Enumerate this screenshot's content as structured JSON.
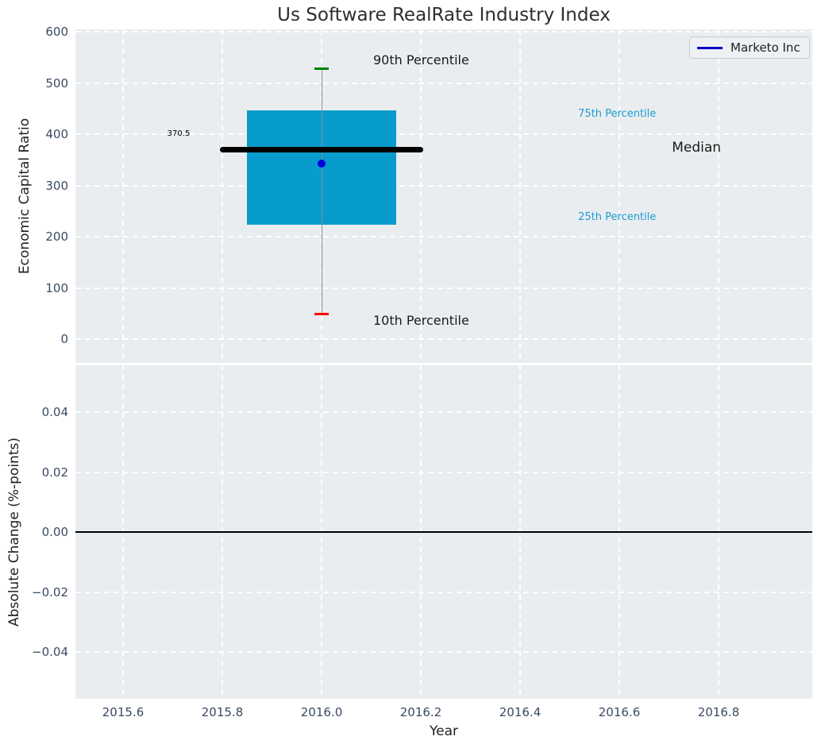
{
  "title": "Us Software RealRate Industry Index",
  "legend": {
    "label": "Marketo Inc",
    "line_color": "#0000cc"
  },
  "chart_data": {
    "type": "boxplot",
    "title": "Us Software RealRate Industry Index",
    "xlabel": "Year",
    "x_ticks": [
      {
        "v": 2015.6,
        "label": "2015.6"
      },
      {
        "v": 2015.8,
        "label": "2015.8"
      },
      {
        "v": 2016.0,
        "label": "2016.0"
      },
      {
        "v": 2016.2,
        "label": "2016.2"
      },
      {
        "v": 2016.4,
        "label": "2016.4"
      },
      {
        "v": 2016.6,
        "label": "2016.6"
      },
      {
        "v": 2016.8,
        "label": "2016.8"
      }
    ],
    "xlim": [
      2015.5,
      2016.99
    ],
    "top_panel": {
      "ylabel": "Economic Capital Ratio",
      "ylim": [
        -46,
        604
      ],
      "y_ticks": [
        {
          "v": 0,
          "label": "0"
        },
        {
          "v": 100,
          "label": "100"
        },
        {
          "v": 200,
          "label": "200"
        },
        {
          "v": 300,
          "label": "300"
        },
        {
          "v": 400,
          "label": "400"
        },
        {
          "v": 500,
          "label": "500"
        },
        {
          "v": 600,
          "label": "600"
        }
      ],
      "box": {
        "x_center": 2016.0,
        "box_x_range": [
          2015.85,
          2016.15
        ],
        "median_x_range": [
          2015.795,
          2016.205
        ],
        "cap_half_width": 0.0145,
        "p10": 50,
        "p25": 223.5,
        "median": 370.5,
        "p75": 446.5,
        "p90": 529,
        "company_value": 343,
        "colors": {
          "box_fill": "#089ccd",
          "median_line": "#000000",
          "whisker_line": "#8a8a8a",
          "cap_top": "#008000",
          "cap_bottom": "#ff0000",
          "company_dot": "#0000dd"
        }
      },
      "annotations": [
        {
          "text": "90th Percentile",
          "x": 2016.104,
          "y": 543,
          "color": "#1a1a1a",
          "size": 16,
          "align": "left"
        },
        {
          "text": "10th Percentile",
          "x": 2016.104,
          "y": 34,
          "color": "#1a1a1a",
          "size": 16,
          "align": "left"
        },
        {
          "text": "75th Percentile",
          "x": 2016.517,
          "y": 437,
          "color": "#1a9cd4",
          "size": 13,
          "align": "left"
        },
        {
          "text": "25th Percentile",
          "x": 2016.517,
          "y": 236,
          "color": "#1a9cd4",
          "size": 13,
          "align": "left"
        },
        {
          "text": "Median",
          "x": 2016.706,
          "y": 372,
          "color": "#1a1a1a",
          "size": 17,
          "align": "left"
        },
        {
          "text": "370.5",
          "x": 2015.712,
          "y": 399,
          "color": "#000000",
          "size": 10,
          "align": "center"
        }
      ]
    },
    "bottom_panel": {
      "ylabel": "Absolute Change (%-points)",
      "ylim": [
        -0.0556,
        0.0556
      ],
      "y_ticks": [
        {
          "v": 0.04,
          "label": "0.04"
        },
        {
          "v": 0.02,
          "label": "0.02"
        },
        {
          "v": 0.0,
          "label": "0.00"
        },
        {
          "v": -0.02,
          "label": "−0.02"
        },
        {
          "v": -0.04,
          "label": "−0.04"
        }
      ],
      "zero_line": true,
      "series": [
        {
          "name": "Marketo Inc",
          "color": "#0000cc",
          "x": [],
          "y": []
        }
      ]
    }
  }
}
